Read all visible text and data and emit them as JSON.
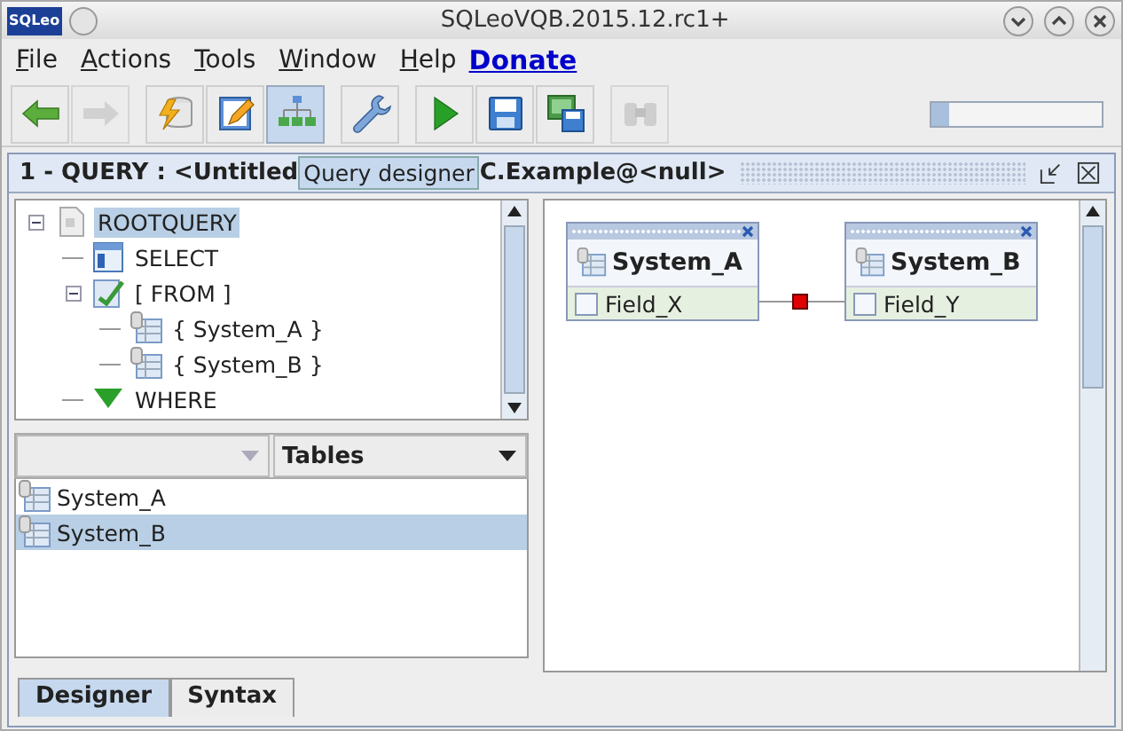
{
  "window": {
    "title": "SQLeoVQB.2015.12.rc1+",
    "app_logo": "SQLeo"
  },
  "menu": [
    {
      "label": "File",
      "kind": "menu"
    },
    {
      "label": "Actions",
      "kind": "menu"
    },
    {
      "label": "Tools",
      "kind": "menu"
    },
    {
      "label": "Window",
      "kind": "menu"
    },
    {
      "label": "Help",
      "kind": "menu"
    },
    {
      "label": "Donate",
      "kind": "link"
    }
  ],
  "toolbar": [
    {
      "kind": "back",
      "disabled": false,
      "pressed": false
    },
    {
      "kind": "forward",
      "disabled": true,
      "pressed": false
    },
    {
      "kind": "sep"
    },
    {
      "kind": "connect",
      "disabled": false,
      "pressed": false
    },
    {
      "kind": "edit",
      "disabled": false,
      "pressed": false
    },
    {
      "kind": "designer",
      "disabled": false,
      "pressed": true
    },
    {
      "kind": "sep"
    },
    {
      "kind": "tools",
      "disabled": false,
      "pressed": false
    },
    {
      "kind": "sep"
    },
    {
      "kind": "run",
      "disabled": false,
      "pressed": false
    },
    {
      "kind": "save",
      "disabled": false,
      "pressed": false
    },
    {
      "kind": "saveas",
      "disabled": false,
      "pressed": false
    },
    {
      "kind": "sep"
    },
    {
      "kind": "find",
      "disabled": true,
      "pressed": false
    }
  ],
  "progress": {
    "level": 0.1
  },
  "query_frame": {
    "title_start": "1 - QUERY : <Untitled",
    "title_end": "C.Example@<null>",
    "tooltip": "Query designer"
  },
  "tree": [
    {
      "label": "ROOTQUERY",
      "kind": "root",
      "selected": true,
      "expanded": true,
      "children": [
        {
          "label": "SELECT",
          "kind": "select",
          "selected": false
        },
        {
          "label": "[ FROM ]",
          "kind": "from",
          "selected": false,
          "expanded": true,
          "children": [
            {
              "label": "{ System_A }",
              "kind": "table",
              "selected": false
            },
            {
              "label": "{ System_B }",
              "kind": "table",
              "selected": false
            }
          ]
        },
        {
          "label": "WHERE",
          "kind": "where",
          "selected": false
        }
      ]
    }
  ],
  "list_filter": {
    "value": "Tables"
  },
  "table_list": [
    {
      "label": "System_A",
      "selected": false
    },
    {
      "label": "System_B",
      "selected": true
    }
  ],
  "bottom_tabs": [
    {
      "label": "Designer",
      "selected": true
    },
    {
      "label": "Syntax",
      "selected": false
    }
  ],
  "diagram": {
    "entities": [
      {
        "name": "System_A",
        "fields": [
          {
            "name": "Field_X",
            "checked": false
          }
        ]
      },
      {
        "name": "System_B",
        "fields": [
          {
            "name": "Field_Y",
            "checked": false
          }
        ]
      }
    ]
  }
}
